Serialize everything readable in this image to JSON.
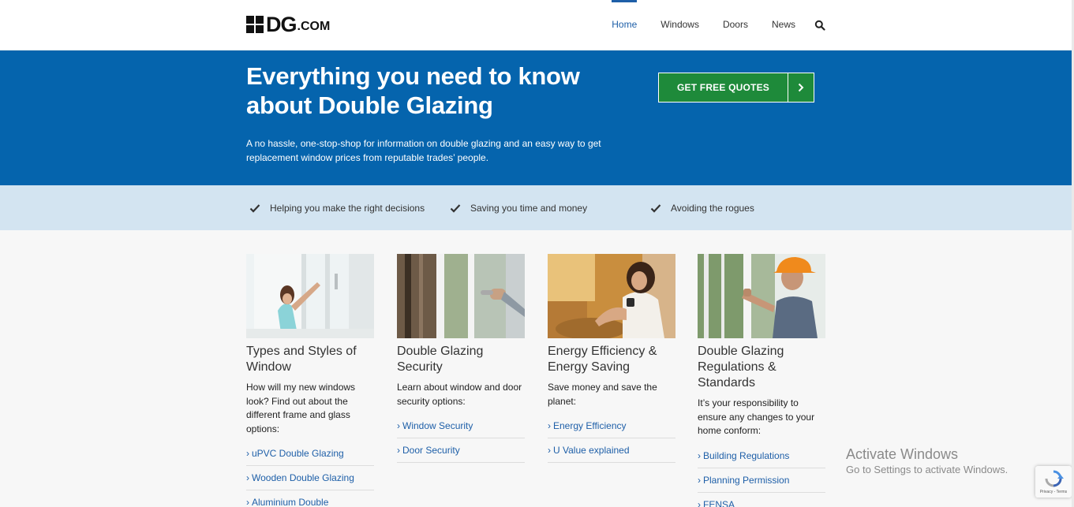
{
  "header": {
    "logo_main": "DG",
    "logo_suffix": ".COM",
    "nav": [
      {
        "label": "Home"
      },
      {
        "label": "Windows"
      },
      {
        "label": "Doors"
      },
      {
        "label": "News"
      }
    ]
  },
  "hero": {
    "title": "Everything you need to know about Double Glazing",
    "subtitle": "A no hassle, one-stop-shop for information on double glazing and an easy way to get replacement window prices from reputable trades’ people.",
    "cta_label": "GET FREE QUOTES"
  },
  "benefits": [
    {
      "label": "Helping you make the right decisions"
    },
    {
      "label": "Saving you time and money"
    },
    {
      "label": "Avoiding the rogues"
    }
  ],
  "cards": [
    {
      "title": "Types and Styles of Window",
      "desc": "How will my new windows look? Find out about the different frame and glass options:",
      "links": [
        "uPVC Double Glazing",
        "Wooden Double Glazing",
        "Aluminium Double"
      ]
    },
    {
      "title": "Double Glazing Security",
      "desc": "Learn about window and door security options:",
      "links": [
        "Window Security",
        "Door Security"
      ]
    },
    {
      "title": "Energy Efficiency & Energy Saving",
      "desc": "Save money and save the planet:",
      "links": [
        "Energy Efficiency",
        "U Value explained"
      ]
    },
    {
      "title": "Double Glazing Regulations & Standards",
      "desc": "It’s your responsibility to ensure any changes to your home conform:",
      "links": [
        "Building Regulations",
        "Planning Permission",
        "FENSA"
      ]
    }
  ],
  "overlay": {
    "activate_title": "Activate Windows",
    "activate_sub": "Go to Settings to activate Windows.",
    "recaptcha_text": "Privacy - Terms"
  },
  "colors": {
    "brand_blue": "#0564ad",
    "link_blue": "#1e5fa8",
    "cta_green": "#1e8a3a",
    "benefit_bg": "#d3e4f1"
  },
  "icons": [
    "search-icon",
    "check-icon",
    "chevron-right-icon",
    "recaptcha-icon"
  ]
}
